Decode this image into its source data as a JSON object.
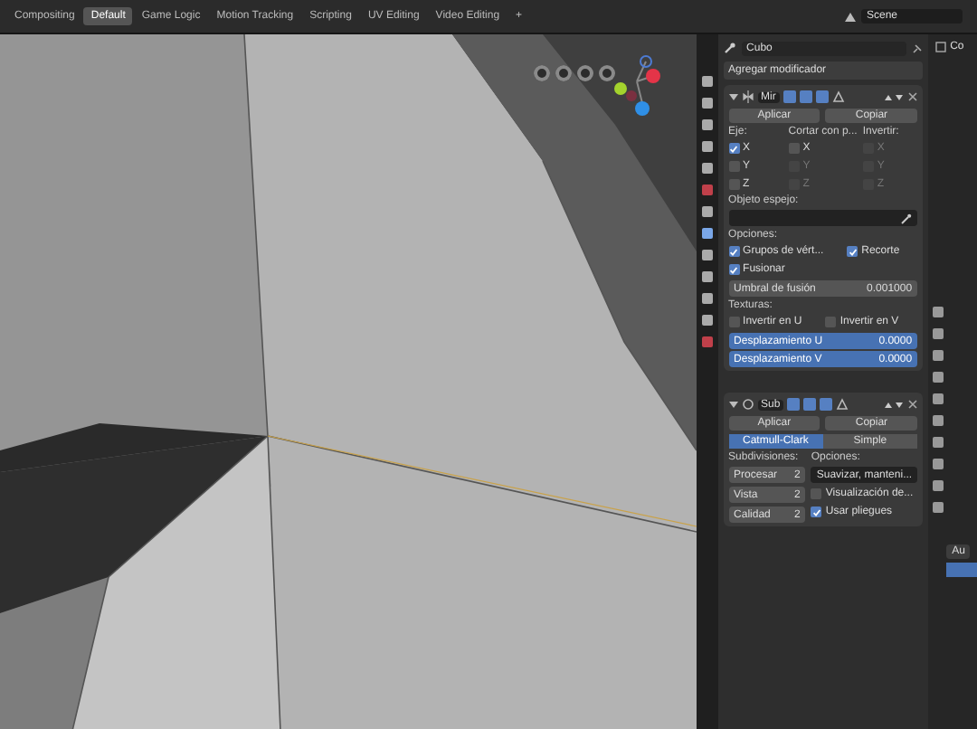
{
  "workspace_tabs": [
    {
      "label": "Compositing",
      "selected": false
    },
    {
      "label": "Default",
      "selected": true
    },
    {
      "label": "Game Logic",
      "selected": false
    },
    {
      "label": "Motion Tracking",
      "selected": false
    },
    {
      "label": "Scripting",
      "selected": false
    },
    {
      "label": "UV Editing",
      "selected": false
    },
    {
      "label": "Video Editing",
      "selected": false
    }
  ],
  "add_tab": "+",
  "scene_field": {
    "value": "Scene"
  },
  "properties": {
    "object_name": "Cubo",
    "add_modifier": "Agregar modificador",
    "mirror": {
      "name": "Mir",
      "expanded": true,
      "apply": "Aplicar",
      "copy": "Copiar",
      "axis_label": "Eje:",
      "bisect_label": "Cortar con p...",
      "flip_label": "Invertir:",
      "axes": [
        {
          "label": "X",
          "checked": true,
          "disabled": false
        },
        {
          "label": "Y",
          "checked": false,
          "disabled": false
        },
        {
          "label": "Z",
          "checked": false,
          "disabled": false
        }
      ],
      "bisect": [
        {
          "label": "X",
          "checked": false,
          "disabled": false
        },
        {
          "label": "Y",
          "checked": false,
          "disabled": true
        },
        {
          "label": "Z",
          "checked": false,
          "disabled": true
        }
      ],
      "flip": [
        {
          "label": "X",
          "checked": false,
          "disabled": true
        },
        {
          "label": "Y",
          "checked": false,
          "disabled": true
        },
        {
          "label": "Z",
          "checked": false,
          "disabled": true
        }
      ],
      "mirror_object_label": "Objeto espejo:",
      "options_label": "Opciones:",
      "options": [
        {
          "label": "Grupos de vért...",
          "checked": true
        },
        {
          "label": "Recorte",
          "checked": true
        },
        {
          "label": "Fusionar",
          "checked": true
        }
      ],
      "merge": {
        "label": "Umbral de fusión",
        "value": "0.001000"
      },
      "textures_label": "Texturas:",
      "texture_flips": [
        {
          "label": "Invertir en U",
          "checked": false
        },
        {
          "label": "Invertir en V",
          "checked": false
        }
      ],
      "offsets": [
        {
          "label": "Desplazamiento U",
          "value": "0.0000",
          "selected": true
        },
        {
          "label": "Desplazamiento V",
          "value": "0.0000",
          "selected": true
        }
      ]
    },
    "subsurf": {
      "name": "Sub",
      "expanded": true,
      "apply": "Aplicar",
      "copy": "Copiar",
      "tabs": [
        {
          "label": "Catmull-Clark",
          "selected": true
        },
        {
          "label": "Simple",
          "selected": false
        }
      ],
      "subdiv_label": "Subdivisiones:",
      "options_label": "Opciones:",
      "fields": [
        {
          "label": "Procesar",
          "value": "2"
        },
        {
          "label": "Vista",
          "value": "2"
        },
        {
          "label": "Calidad",
          "value": "2"
        }
      ],
      "uv_smooth": "Suavizar, manteni...",
      "checks": [
        {
          "label": "Visualización de...",
          "checked": false
        },
        {
          "label": "Usar pliegues",
          "checked": true
        }
      ]
    }
  },
  "right_fragments": {
    "top": "Co",
    "bottom": "Au"
  }
}
